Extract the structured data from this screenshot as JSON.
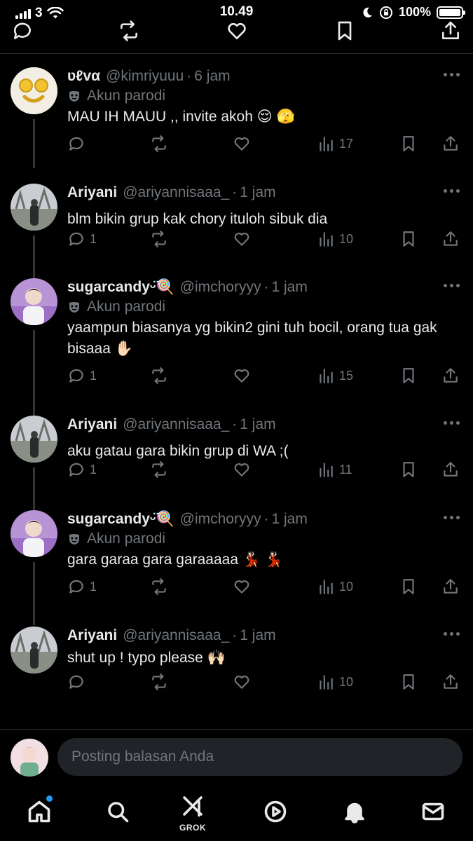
{
  "status_bar": {
    "carrier": "3",
    "time": "10.49",
    "battery": "100%"
  },
  "tweets": [
    {
      "name": "ʋℓvα",
      "handle": "@kimriyuuu",
      "time": "6 jam",
      "parody_label": "Akun parodi",
      "text": "MAU IH MAUU ,, invite akoh 😌 🫣",
      "replies": "",
      "views": "17"
    },
    {
      "name": "Ariyani",
      "handle": "@ariyannisaaa_",
      "time": "1 jam",
      "parody_label": "",
      "text": "blm bikin grup kak chory ituloh sibuk dia",
      "replies": "1",
      "views": "10"
    },
    {
      "name": "sugarcandyᵕ̈🍭",
      "handle": "@imchoryyy",
      "time": "1 jam",
      "parody_label": "Akun parodi",
      "text": "yaampun biasanya yg bikin2 gini tuh bocil, orang tua gak bisaaa ✋🏻",
      "replies": "1",
      "views": "15"
    },
    {
      "name": "Ariyani",
      "handle": "@ariyannisaaa_",
      "time": "1 jam",
      "parody_label": "",
      "text": "aku gatau gara bikin grup di WA ;(",
      "replies": "1",
      "views": "11"
    },
    {
      "name": "sugarcandyᵕ̈🍭",
      "handle": "@imchoryyy",
      "time": "1 jam",
      "parody_label": "Akun parodi",
      "text": "gara garaa gara garaaaaa 💃🏻 💃🏻",
      "replies": "1",
      "views": "10"
    },
    {
      "name": "Ariyani",
      "handle": "@ariyannisaaa_",
      "time": "1 jam",
      "parody_label": "",
      "text": "shut up ! typo please 🙌🏻",
      "replies": "",
      "views": "10"
    }
  ],
  "composer": {
    "placeholder": "Posting balasan Anda"
  },
  "nav": {
    "grok_label": "GROK"
  },
  "colors": {
    "background": "#000000",
    "text": "#e7e9ea",
    "muted": "#71767b",
    "accent": "#1d9bf0",
    "input_bg": "#202327"
  }
}
